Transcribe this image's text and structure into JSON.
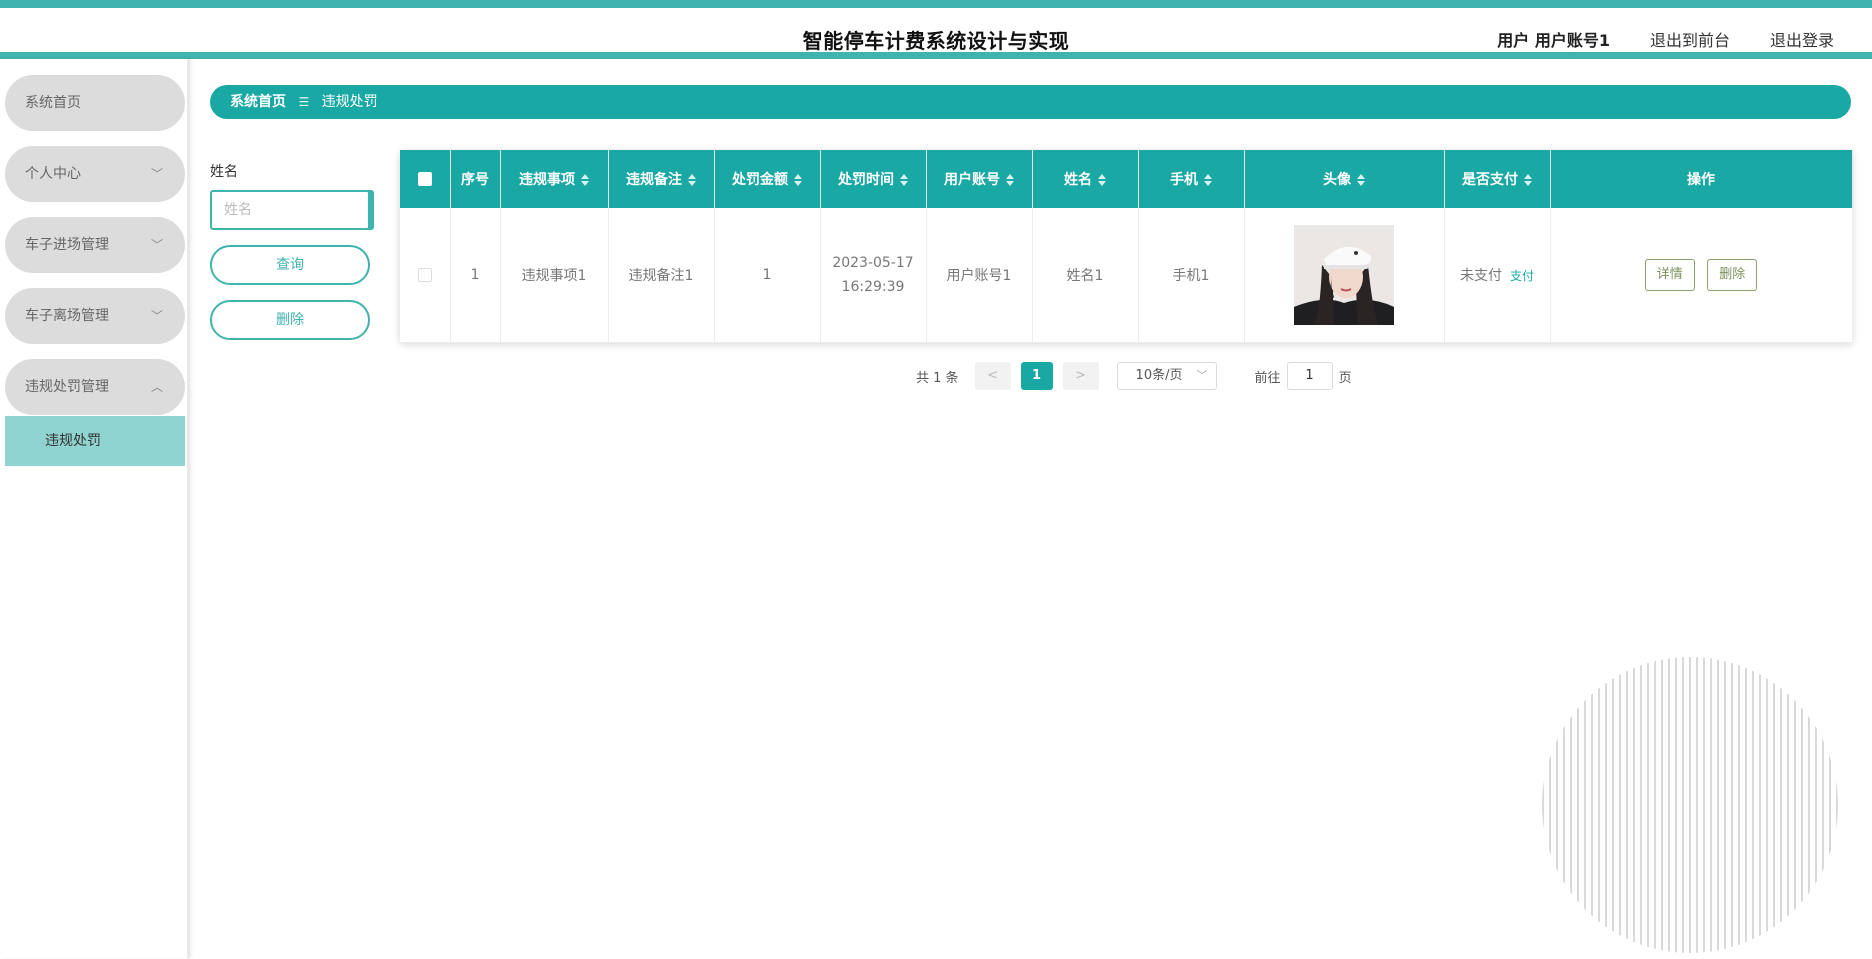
{
  "header": {
    "title": "智能停车计费系统设计与实现",
    "user": "用户 用户账号1",
    "to_front": "退出到前台",
    "logout": "退出登录"
  },
  "sidebar": {
    "items": [
      {
        "label": "系统首页",
        "chevron": ""
      },
      {
        "label": "个人中心",
        "chevron": "﹀"
      },
      {
        "label": "车子进场管理",
        "chevron": "﹀"
      },
      {
        "label": "车子离场管理",
        "chevron": "﹀"
      },
      {
        "label": "违规处罚管理",
        "chevron": "︿"
      }
    ],
    "sub_item": "违规处罚"
  },
  "breadcrumb": {
    "home": "系统首页",
    "sep": "☰",
    "current": "违规处罚"
  },
  "search": {
    "label": "姓名",
    "placeholder": "姓名",
    "query_button": "查询",
    "delete_button": "删除"
  },
  "table": {
    "columns": [
      "序号",
      "违规事项",
      "违规备注",
      "处罚金额",
      "处罚时间",
      "用户账号",
      "姓名",
      "手机",
      "头像",
      "是否支付",
      "操作"
    ],
    "rows": [
      {
        "index": "1",
        "item": "违规事项1",
        "note": "违规备注1",
        "amount": "1",
        "date": "2023-05-17",
        "time": "16:29:39",
        "account": "用户账号1",
        "name": "姓名1",
        "phone": "手机1",
        "avatar_icon": "avatar-photo",
        "paid": "未支付",
        "pay_link": "支付",
        "detail_button": "详情",
        "delete_button": "删除"
      }
    ]
  },
  "pagination": {
    "total": "共 1 条",
    "prev": "<",
    "page": "1",
    "next": ">",
    "page_size": "10条/页",
    "goto_label": "前往",
    "goto_value": "1",
    "page_suffix": "页"
  },
  "colors": {
    "accent": "#1aa8a5",
    "accent_light": "#8fd4d0",
    "menu_bg": "#dcdcdc"
  }
}
